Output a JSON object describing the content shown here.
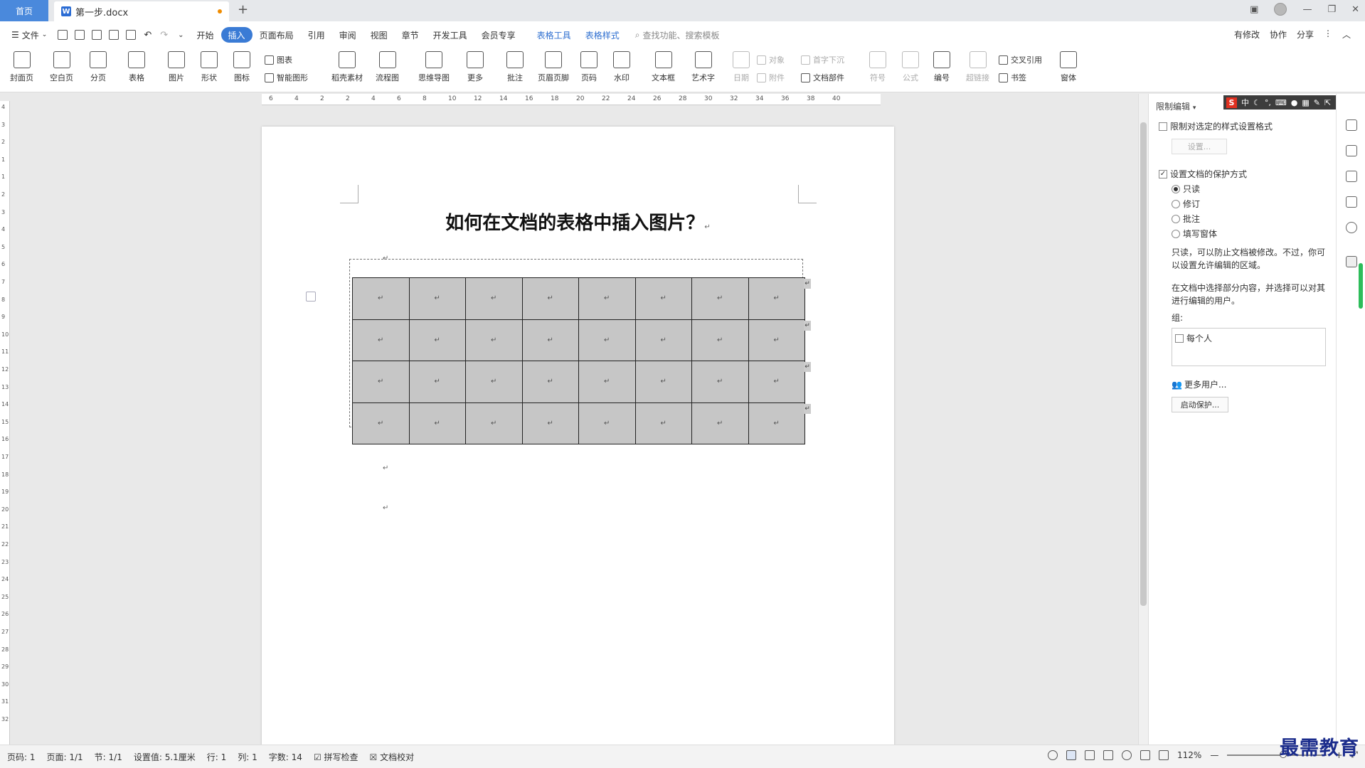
{
  "titlebar": {
    "home_tab": "首页",
    "doc_tab": "第一步.docx",
    "doc_icon": "W",
    "new_tab_icon": "+"
  },
  "menubar": {
    "file_menu": "文件",
    "items": [
      "开始",
      "插入",
      "页面布局",
      "引用",
      "审阅",
      "视图",
      "章节",
      "开发工具",
      "会员专享"
    ],
    "active_item": "插入",
    "tool_tabs": [
      "表格工具",
      "表格样式"
    ],
    "search_placeholder": "查找功能、搜索模板",
    "right": [
      "有修改",
      "协作",
      "分享"
    ]
  },
  "ribbon": {
    "cover": "封面页",
    "blank": "空白页",
    "page_break": "分页",
    "table": "表格",
    "picture": "图片",
    "shape": "形状",
    "icon": "图标",
    "chart": "图表",
    "smart_art": "智能图形",
    "material": "稻壳素材",
    "flowchart": "流程图",
    "mindmap": "思维导图",
    "more": "更多",
    "comment": "批注",
    "header_footer": "页眉页脚",
    "page_number": "页码",
    "watermark": "水印",
    "textbox": "文本框",
    "wordart": "艺术字",
    "date": "日期",
    "object": "对象",
    "attachment": "附件",
    "drop_cap": "首字下沉",
    "doc_parts": "文档部件",
    "symbol": "符号",
    "formula": "公式",
    "numbering": "编号",
    "hyperlink": "超链接",
    "cross_ref": "交叉引用",
    "bookmark": "书签",
    "window": "窗体"
  },
  "ruler": {
    "h_ticks": [
      "6",
      "4",
      "2",
      "2",
      "4",
      "6",
      "8",
      "10",
      "12",
      "14",
      "16",
      "18",
      "20",
      "22",
      "24",
      "26",
      "28",
      "30",
      "32",
      "34",
      "36",
      "38",
      "40"
    ],
    "v_ticks": [
      "4",
      "3",
      "2",
      "1",
      "1",
      "2",
      "3",
      "4",
      "5",
      "6",
      "7",
      "8",
      "9",
      "10",
      "11",
      "12",
      "13",
      "14",
      "15",
      "16",
      "17",
      "18",
      "19",
      "20",
      "21",
      "22",
      "23",
      "24",
      "25",
      "26",
      "27",
      "28",
      "29",
      "30",
      "31",
      "32"
    ]
  },
  "document": {
    "title": "如何在文档的表格中插入图片？",
    "para_mark": "↵",
    "table_rows": 4,
    "table_cols": 8
  },
  "panel": {
    "title": "限制编辑",
    "restrict_format_label": "限制对选定的样式设置格式",
    "settings_btn": "设置...",
    "protect_label": "设置文档的保护方式",
    "options": [
      "只读",
      "修订",
      "批注",
      "填写窗体"
    ],
    "selected_option": "只读",
    "desc1": "只读，可以防止文档被修改。不过，你可以设置允许编辑的区域。",
    "desc2": "在文档中选择部分内容，并选择可以对其进行编辑的用户。",
    "group_label": "组:",
    "everyone": "每个人",
    "more_users": "更多用户...",
    "start_protect_btn": "启动保护..."
  },
  "ime": {
    "logo": "S",
    "mode": "中"
  },
  "statusbar": {
    "page_num": "页码: 1",
    "pages": "页面: 1/1",
    "section": "节: 1/1",
    "setting": "设置值: 5.1厘米",
    "row": "行: 1",
    "col": "列: 1",
    "words": "字数: 14",
    "spell": "拼写检查",
    "proof": "文档校对",
    "zoom": "112%",
    "zoom_level": 0.56
  },
  "watermark": "最需教育",
  "colors": {
    "accent": "#3a7bd5",
    "home_tab": "#4a89dc",
    "table_fill": "#c6c6c6",
    "watermark": "#1b2c8c"
  }
}
